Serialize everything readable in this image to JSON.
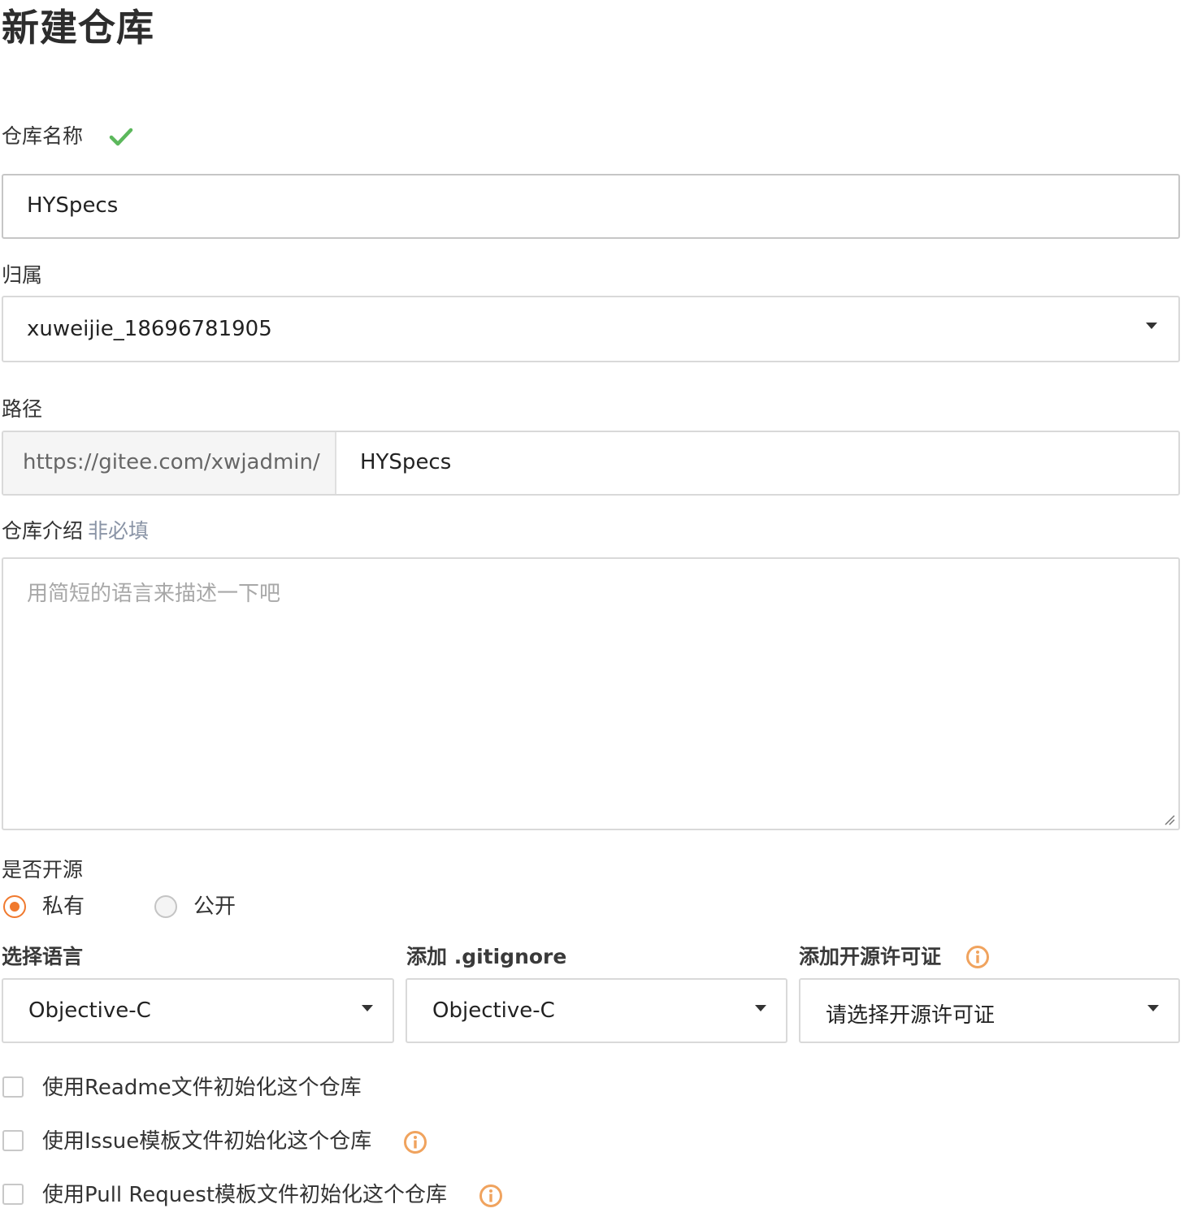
{
  "page": {
    "title": "新建仓库"
  },
  "repo_name": {
    "label": "仓库名称",
    "value": "HYSpecs",
    "valid_icon": "checkmark-icon"
  },
  "owner": {
    "label": "归属",
    "selected": "xuweijie_18696781905"
  },
  "path": {
    "label": "路径",
    "prefix": "https://gitee.com/xwjadmin/",
    "value": "HYSpecs"
  },
  "description": {
    "label": "仓库介绍",
    "optional_hint": "非必填",
    "placeholder": "用简短的语言来描述一下吧",
    "value": ""
  },
  "visibility": {
    "label": "是否开源",
    "options": [
      {
        "label": "私有",
        "checked": true
      },
      {
        "label": "公开",
        "checked": false
      }
    ]
  },
  "language": {
    "label": "选择语言",
    "selected": "Objective-C"
  },
  "gitignore": {
    "label": "添加 .gitignore",
    "selected": "Objective-C"
  },
  "license": {
    "label": "添加开源许可证",
    "selected": "请选择开源许可证",
    "info_icon": "info-icon"
  },
  "init_options": [
    {
      "label": "使用Readme文件初始化这个仓库",
      "checked": false,
      "has_info": false
    },
    {
      "label": "使用Issue模板文件初始化这个仓库",
      "checked": false,
      "has_info": true
    },
    {
      "label": "使用Pull Request模板文件初始化这个仓库",
      "checked": false,
      "has_info": true
    }
  ],
  "colors": {
    "accent": "#f0792e",
    "success": "#5cb85c",
    "info_orange": "#f0a35e",
    "border": "#d9d9d9",
    "muted": "#8a94a6"
  }
}
